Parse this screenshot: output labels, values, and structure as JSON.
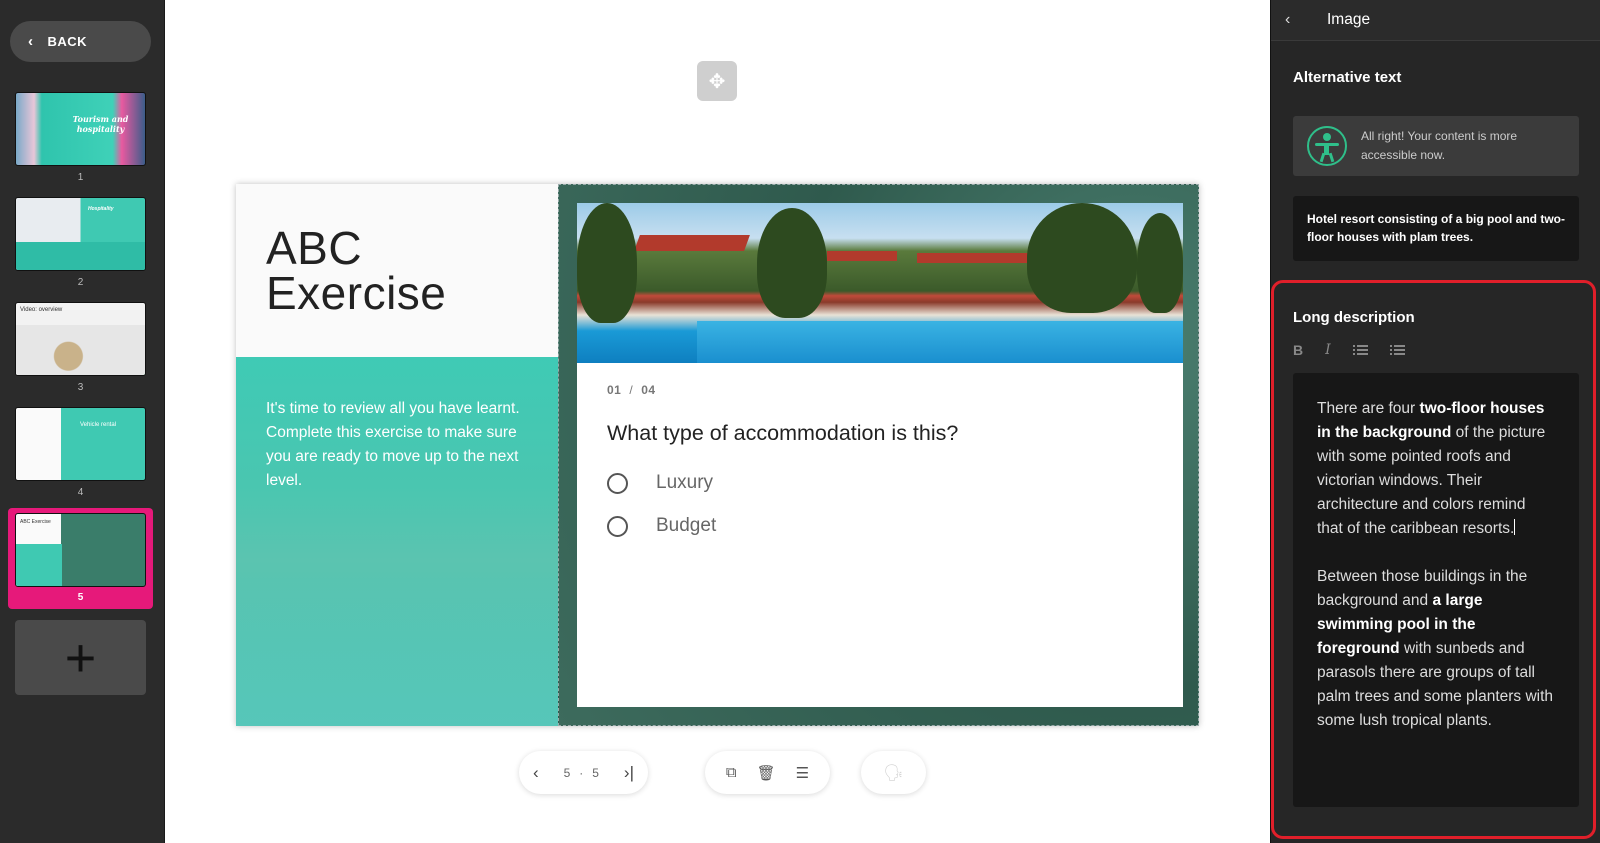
{
  "sidebar": {
    "back_label": "BACK",
    "slides": [
      {
        "num": "1",
        "thumb_text": "Tourism and hospitality"
      },
      {
        "num": "2",
        "thumb_text": "Hospitality"
      },
      {
        "num": "3",
        "thumb_text": "Video: overview"
      },
      {
        "num": "4",
        "thumb_text": "Vehicle rental"
      },
      {
        "num": "5",
        "thumb_text": "ABC Exercise"
      }
    ],
    "active_slide": "5",
    "add_label": "+"
  },
  "slide": {
    "title_line1": "ABC",
    "title_line2": "Exercise",
    "description": "It's time to review all you have learnt. Complete this exercise to make sure you are ready to move up to the next level.",
    "counter_current": "01",
    "counter_separator": "/",
    "counter_total": "04",
    "question": "What type of accommodation is this?",
    "options": [
      "Luxury",
      "Budget"
    ]
  },
  "toolbar": {
    "page_current": "5",
    "page_dot": "·",
    "page_total": "5"
  },
  "panel": {
    "title": "Image",
    "alt_heading": "Alternative text",
    "a11y_message": "All right! Your content is more accessible now.",
    "alt_text": "Hotel resort consisting of a big pool and two-floor houses with plam trees.",
    "long_heading": "Long description",
    "long_p1": [
      {
        "t": "There are four ",
        "b": false
      },
      {
        "t": "two-floor houses in the background",
        "b": true
      },
      {
        "t": " of the picture with some pointed roofs and victorian windows. Their architecture and colors remind that of the caribbean resorts.",
        "b": false
      }
    ],
    "long_p2": [
      {
        "t": "Between those buildings in the background and ",
        "b": false
      },
      {
        "t": "a large swimming pool in the foreground",
        "b": true
      },
      {
        "t": " with sunbeds and parasols there are groups of tall palm trees and some planters with some lush tropical plants.",
        "b": false
      }
    ]
  },
  "colors": {
    "active_slide": "#e6197a",
    "teal": "#3fcab5",
    "highlight": "#e01f2a",
    "a11y_green": "#2fbf8a"
  }
}
